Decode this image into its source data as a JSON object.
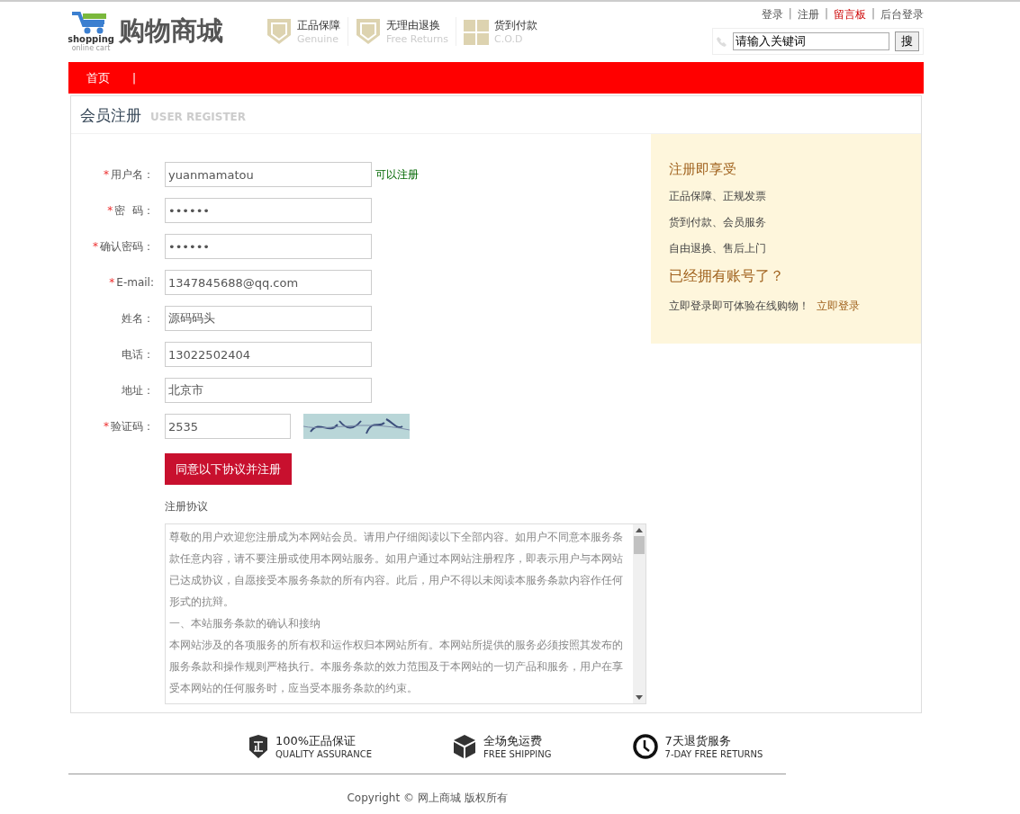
{
  "header": {
    "logo": {
      "name": "购物商城",
      "tagline": "shopping",
      "subtagline": "online cart"
    },
    "badges": [
      {
        "kind": "shield",
        "title": "正品保障",
        "subtitle": "Genuine"
      },
      {
        "kind": "shield",
        "title": "无理由退换",
        "subtitle": "Free Returns"
      },
      {
        "kind": "gift",
        "title": "货到付款",
        "subtitle": "C.O.D"
      }
    ],
    "top_links": [
      {
        "label": "登录",
        "highlight": false
      },
      {
        "label": "注册",
        "highlight": false
      },
      {
        "label": "留言板",
        "highlight": true
      },
      {
        "label": "后台登录",
        "highlight": false
      }
    ],
    "link_separator": "|",
    "search": {
      "value": "请输入关键词",
      "button": "搜"
    }
  },
  "nav": {
    "items": [
      {
        "label": "首页"
      }
    ],
    "separator": "|"
  },
  "page": {
    "title": "会员注册",
    "subtitle": "USER REGISTER"
  },
  "form": {
    "fields": [
      {
        "kind": "text",
        "label": "用户名：",
        "required": true,
        "value": "yuanmamatou",
        "hint": "可以注册"
      },
      {
        "kind": "password",
        "label": "密  码：",
        "required": true,
        "value": "••••••"
      },
      {
        "kind": "password",
        "label": "确认密码：",
        "required": true,
        "value": "••••••"
      },
      {
        "kind": "text",
        "label": "E-mail:",
        "required": true,
        "value": "1347845688@qq.com"
      },
      {
        "kind": "text",
        "label": "姓名：",
        "required": false,
        "value": "源码码头"
      },
      {
        "kind": "text",
        "label": "电话：",
        "required": false,
        "value": "13022502404"
      },
      {
        "kind": "text",
        "label": "地址：",
        "required": false,
        "value": "北京市"
      },
      {
        "kind": "captcha",
        "label": "验证码：",
        "required": true,
        "value": "2535"
      }
    ],
    "required_mark": "*",
    "submit": "同意以下协议并注册",
    "agreement_title": "注册协议",
    "agreement": [
      "尊敬的用户欢迎您注册成为本网站会员。请用户仔细阅读以下全部内容。如用户不同意本服务条款任意内容，请不要注册或使用本网站服务。如用户通过本网站注册程序，即表示用户与本网站已达成协议，自愿接受本服务条款的所有内容。此后，用户不得以未阅读本服务条款内容作任何形式的抗辩。",
      "一、本站服务条款的确认和接纳",
      "本网站涉及的各项服务的所有权和运作权归本网站所有。本网站所提供的服务必须按照其发布的服务条款和操作规则严格执行。本服务条款的效力范围及于本网站的一切产品和服务，用户在享受本网站的任何服务时，应当受本服务条款的约束。"
    ]
  },
  "sidebar": {
    "title": "注册即享受",
    "benefits": [
      "正品保障、正规发票",
      "货到付款、会员服务",
      "自由退换、售后上门"
    ],
    "login_title": "已经拥有账号了？",
    "login_text": "立即登录即可体验在线购物！",
    "login_link": "立即登录"
  },
  "footer": {
    "features": [
      {
        "kind": "shield",
        "title": "100%正品保证",
        "subtitle": "QUALITY ASSURANCE"
      },
      {
        "kind": "box",
        "title": "全场免运费",
        "subtitle": "FREE SHIPPING"
      },
      {
        "kind": "clock",
        "title": "7天退货服务",
        "subtitle": "7-DAY FREE RETURNS"
      }
    ],
    "copyright": "Copyright © 网上商城 版权所有"
  }
}
